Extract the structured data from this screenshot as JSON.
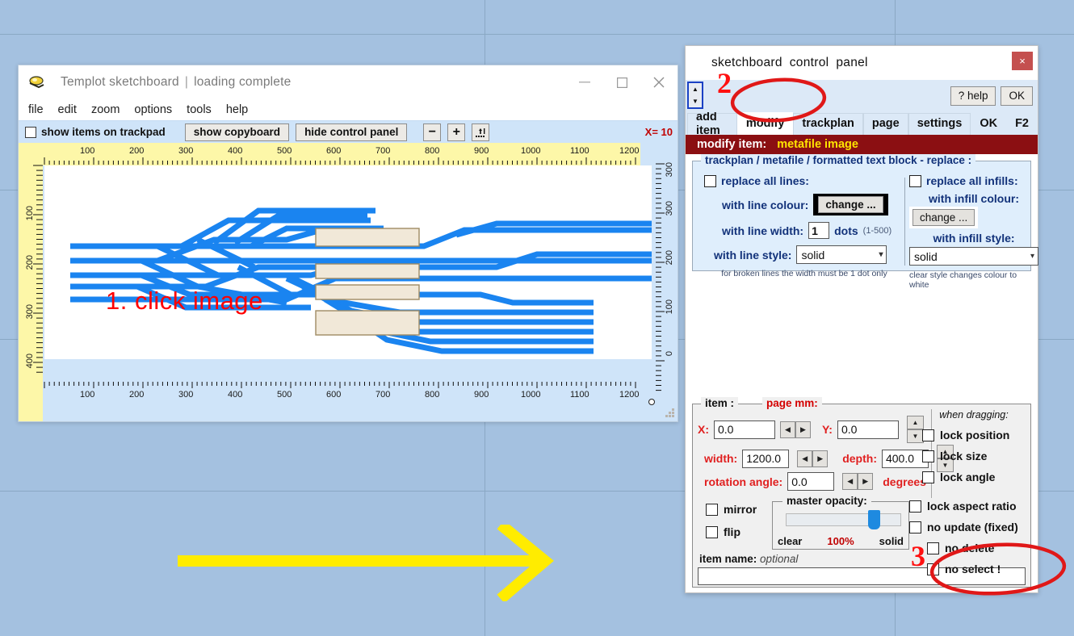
{
  "desktop": {
    "background_color": "#a4c1e0",
    "gridline_color": "#8aa8c4"
  },
  "annotations": {
    "step1": "1. click image",
    "step2": "2",
    "step3": "3",
    "arrow_color": "#ffec00",
    "circle_color": "#e01818",
    "text_color": "#ff0000"
  },
  "templot_window": {
    "logo": "templot-logo-icon",
    "title": "Templot  sketchboard",
    "separator": "|",
    "status": "loading complete",
    "window_buttons": {
      "minimize": "minimize-icon",
      "maximize": "maximize-icon",
      "close": "close-icon"
    },
    "menu": [
      "file",
      "edit",
      "zoom",
      "options",
      "tools",
      "help"
    ],
    "toolbar": {
      "show_items_label": "show items on trackpad",
      "show_items_checked": false,
      "show_copyboard": "show copyboard",
      "hide_control_panel": "hide control panel",
      "zoom_out": "−",
      "zoom_in": "+",
      "fit_icon": "fit-to-page-icon",
      "coords": "X= 10"
    },
    "ruler": {
      "top_labels": [
        "100",
        "200",
        "300",
        "400",
        "500",
        "600",
        "700",
        "800",
        "900",
        "1000",
        "1100",
        "1200"
      ],
      "bottom_labels": [
        "100",
        "200",
        "300",
        "400",
        "500",
        "600",
        "700",
        "800",
        "900",
        "1000",
        "1100",
        "1200"
      ],
      "left_labels": [
        "100",
        "200",
        "300",
        "400"
      ],
      "right_labels": [
        "300",
        "200",
        "100",
        "0"
      ],
      "right_top_label": "300"
    }
  },
  "control_panel": {
    "title_words": [
      "sketchboard",
      "control",
      "panel"
    ],
    "close_label": "×",
    "scroll_spinner": "vertical-spinner",
    "help_button": "? help",
    "ok_button": "OK",
    "tabs": [
      {
        "label": "add item",
        "active": false
      },
      {
        "label": "modify",
        "active": true
      },
      {
        "label": "trackplan",
        "active": false
      },
      {
        "label": "page",
        "active": false
      },
      {
        "label": "settings",
        "active": false
      },
      {
        "label": "OK",
        "active": false,
        "plain": true
      },
      {
        "label": "F2",
        "active": false,
        "plain": true
      }
    ],
    "banner": {
      "label": "modify item:",
      "value": "metafile image",
      "bg_color": "#8b0f12",
      "value_color": "#ffe400"
    },
    "replace_group": {
      "legend": "trackplan / metafile / formatted text block  -  replace :",
      "lines": {
        "checkbox_label": "replace all lines:",
        "checked": false,
        "colour_label": "with line colour:",
        "colour_swatch": "#000000",
        "colour_button": "change ...",
        "width_label": "with line width:",
        "width_value": "1",
        "width_unit": "dots",
        "width_range": "(1-500)",
        "style_label": "with line style:",
        "style_value": "solid",
        "hint": "for broken lines the width must be 1 dot only"
      },
      "infills": {
        "checkbox_label": "replace all infills:",
        "checked": false,
        "colour_label": "with infill colour:",
        "colour_swatch": "#ffffff",
        "colour_button": "change ...",
        "style_label": "with infill style:",
        "style_value": "solid",
        "hint": "clear style changes colour to white"
      }
    },
    "item_group": {
      "legend": "item :",
      "legend2": "page mm:",
      "x_label": "X:",
      "x_value": "0.0",
      "y_label": "Y:",
      "y_value": "0.0",
      "width_label": "width:",
      "width_value": "1200.0",
      "depth_label": "depth:",
      "depth_value": "400.0",
      "rotation_label": "rotation angle:",
      "rotation_value": "0.0",
      "degrees_label": "degrees",
      "mirror_label": "mirror",
      "mirror_checked": false,
      "flip_label": "flip",
      "flip_checked": false,
      "opacity_legend": "master opacity:",
      "opacity_min": "clear",
      "opacity_value": "100%",
      "opacity_max": "solid",
      "itemname_label": "item name:",
      "itemname_hint": "optional",
      "itemname_value": "",
      "drag_title": "when dragging:",
      "drag_options": [
        {
          "label": "lock position",
          "checked": false
        },
        {
          "label": "lock size",
          "checked": false
        },
        {
          "label": "lock angle",
          "checked": false
        }
      ],
      "lock_options": [
        {
          "label": "lock aspect ratio",
          "checked": false
        },
        {
          "label": "no update (fixed)",
          "checked": false
        },
        {
          "label": "no delete",
          "checked": false
        },
        {
          "label": "no select !",
          "checked": false
        }
      ]
    }
  }
}
